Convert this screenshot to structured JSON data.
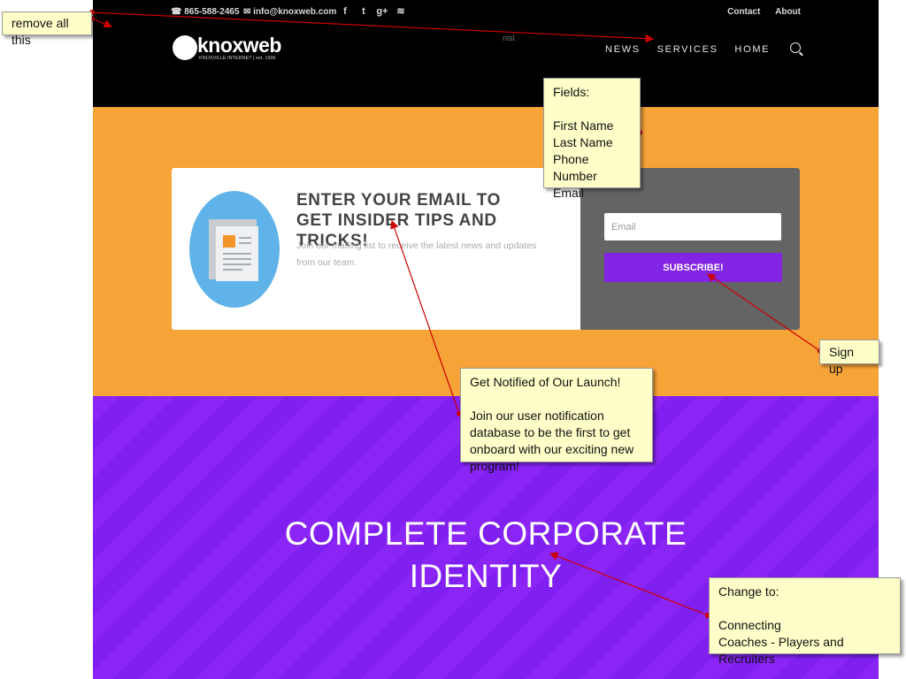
{
  "header": {
    "phone": "865-588-2465",
    "email": "info@knoxweb.com",
    "social_icons": [
      "facebook-icon",
      "twitter-icon",
      "google-plus-icon",
      "rss-icon"
    ],
    "social_glyphs": [
      "f",
      "t",
      "g+",
      "≋"
    ],
    "top_links": [
      "Contact",
      "About"
    ],
    "faint_text": "nisl.",
    "logo_text": "knoxweb",
    "logo_tagline": "KNOXVILLE INTERNET | est. 1996",
    "nav": [
      "NEWS",
      "SERVICES",
      "HOME"
    ]
  },
  "optin": {
    "title": "ENTER YOUR EMAIL TO GET INSIDER TIPS AND TRICKS!",
    "body": "Join our mailing list to receive the latest news and updates from our team.",
    "email_placeholder": "Email",
    "subscribe_label": "SUBSCRIBE!"
  },
  "hero": {
    "line1": "COMPLETE CORPORATE",
    "line2": "IDENTITY"
  },
  "annotations": {
    "remove": "remove all this",
    "fields": "Fields:\n\nFirst Name\nLast Name\nPhone Number\nEmail",
    "signup": "Sign up",
    "notify": "Get Notified of Our Launch!\n\nJoin our user notification database to be the first to get onboard with our exciting new program!",
    "change": "Change to:\n\nConnecting\nCoaches - Players and Recruiters"
  },
  "colors": {
    "orange": "#f6a338",
    "purple": "#8b25f6",
    "button": "#8224e3",
    "note_bg": "#fefec8",
    "arrow": "#cc0000"
  }
}
